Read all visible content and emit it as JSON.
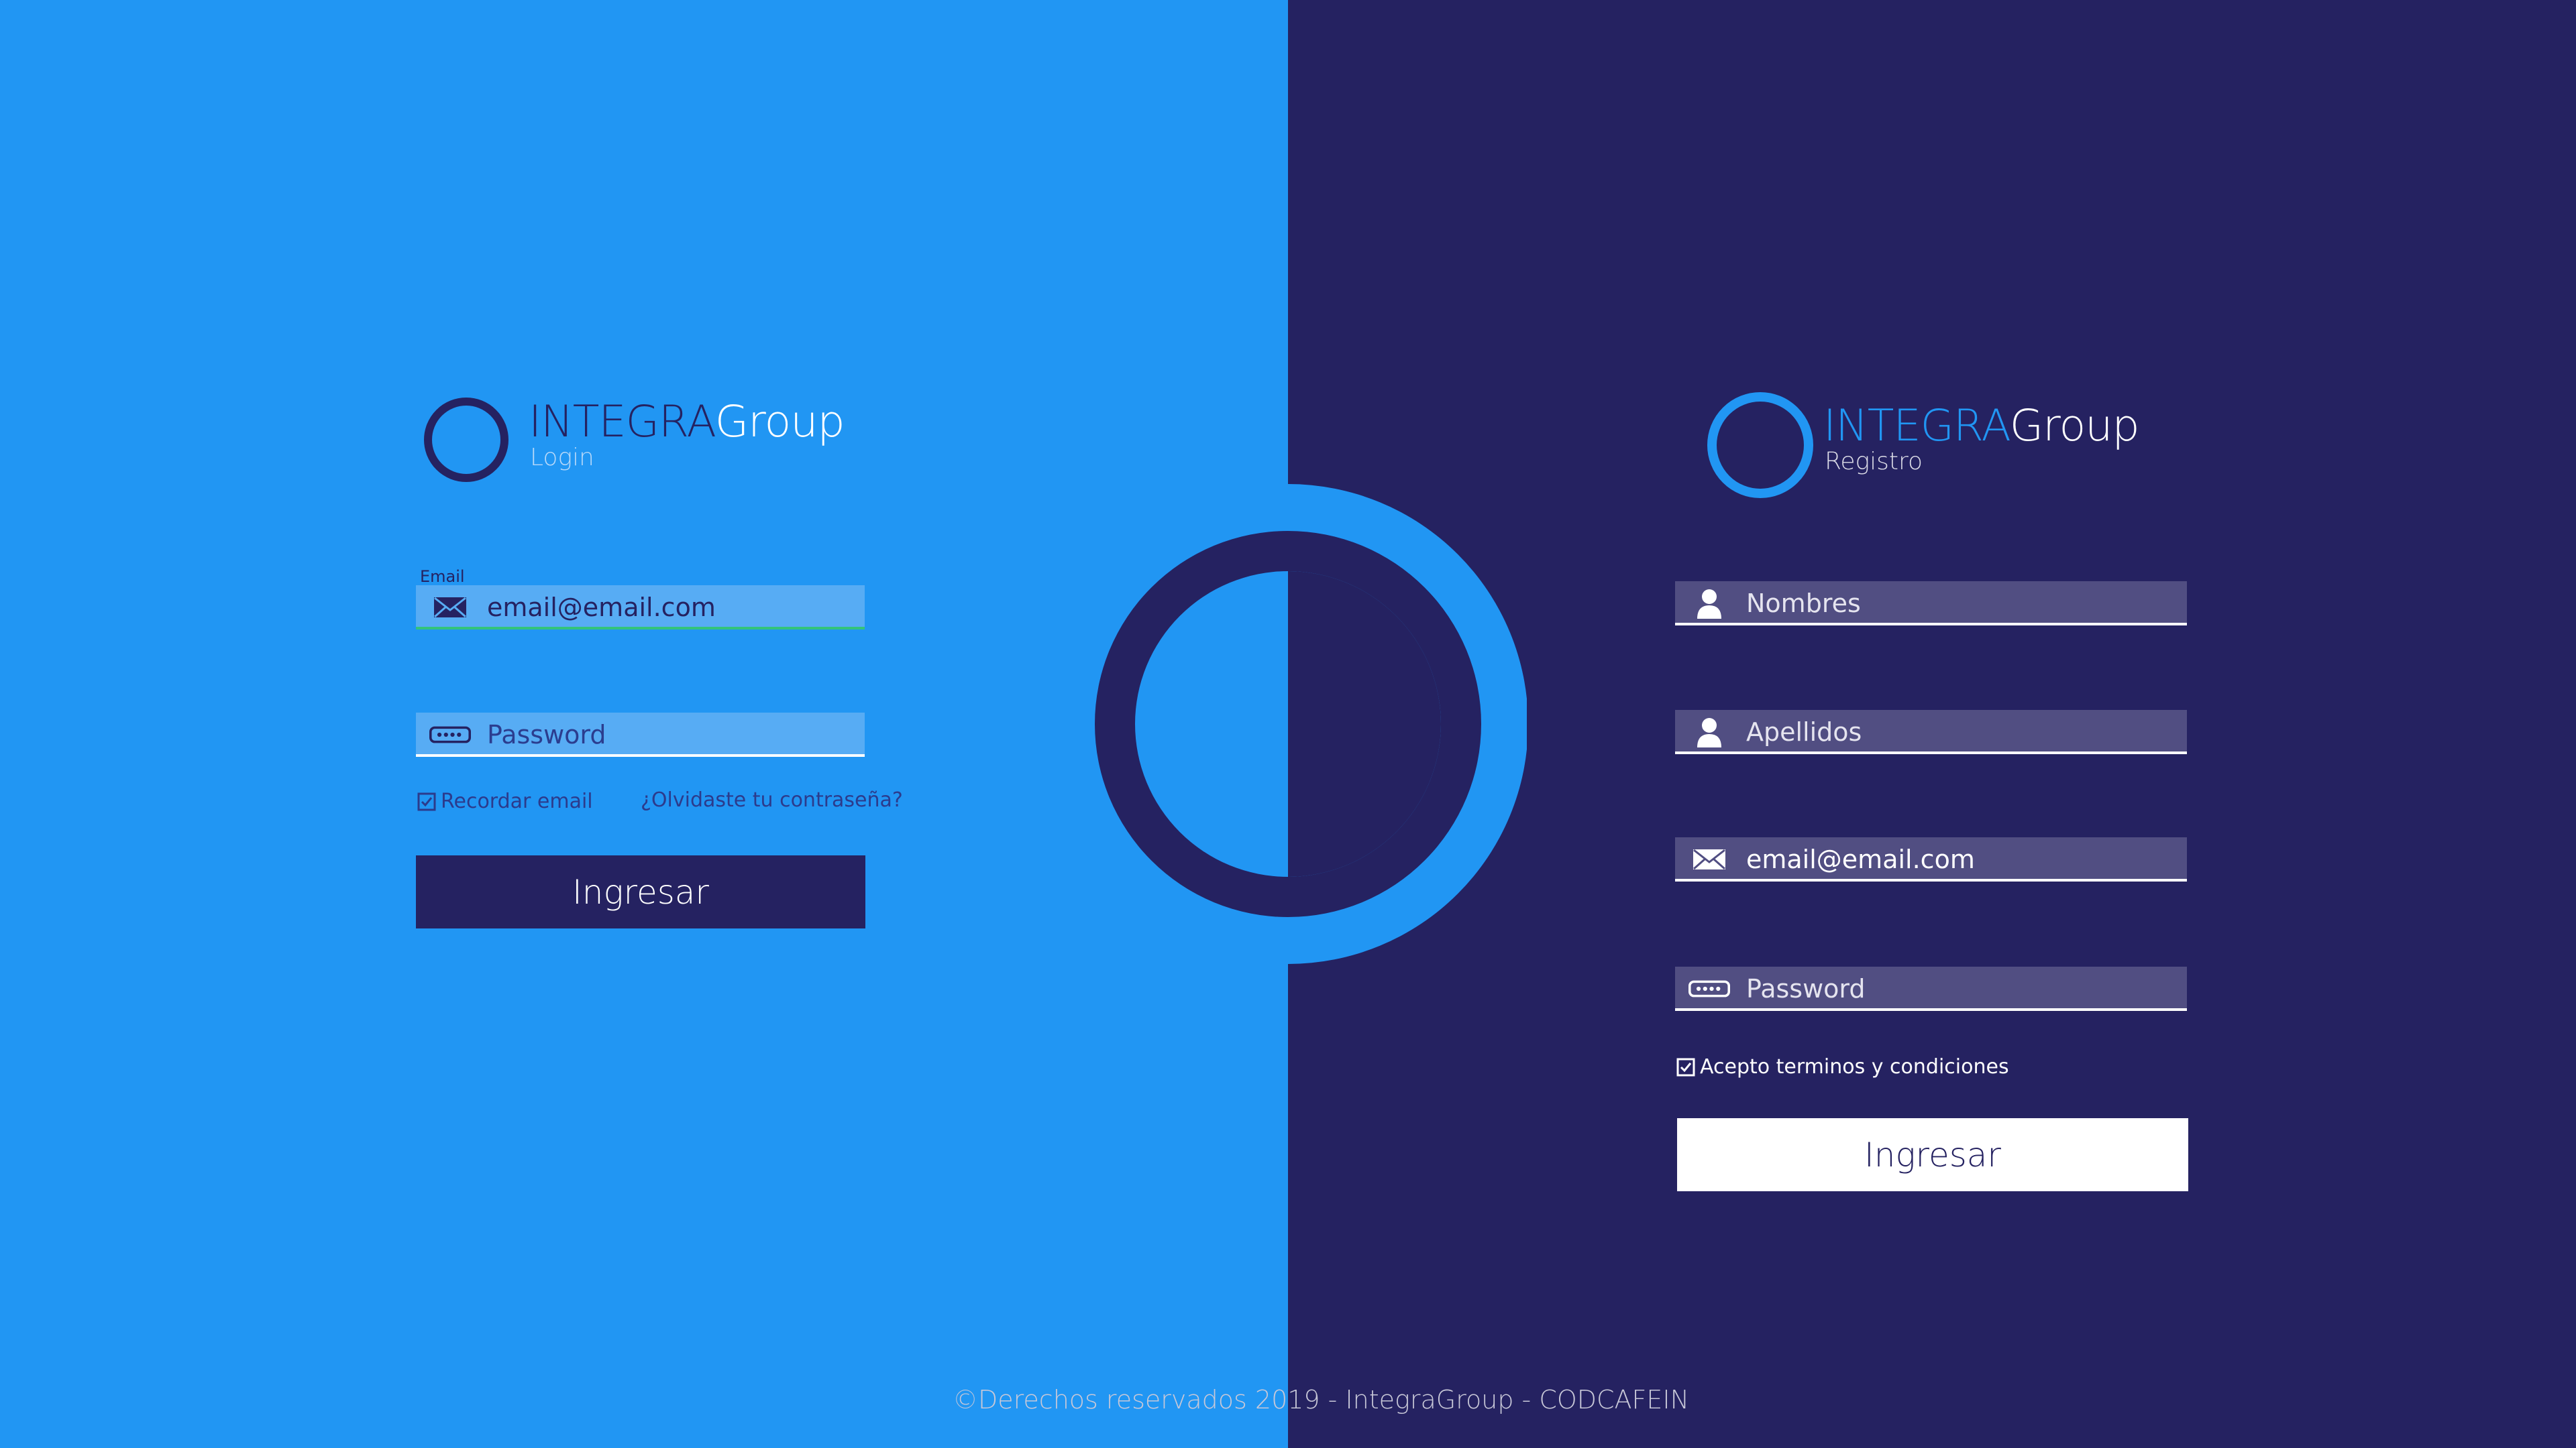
{
  "colors": {
    "blue": "#2196f3",
    "navy": "#252261",
    "white": "#ffffff"
  },
  "login": {
    "brand_prefix": "INTEGRA",
    "brand_suffix": "Group",
    "subtitle": "Login",
    "email_label": "Email",
    "email_value": "email@email.com",
    "email_icon": "envelope-icon",
    "password_placeholder": "Password",
    "password_icon": "password-dots-icon",
    "remember_label": "Recordar email",
    "remember_checked": true,
    "forgot_link": "¿Olvidaste tu contraseña?",
    "submit_label": "Ingresar"
  },
  "register": {
    "brand_prefix": "INTEGRA",
    "brand_suffix": "Group",
    "subtitle": "Registro",
    "names_placeholder": "Nombres",
    "surnames_placeholder": "Apellidos",
    "user_icon": "user-icon",
    "email_value": "email@email.com",
    "email_icon": "envelope-icon",
    "password_placeholder": "Password",
    "password_icon": "password-dots-icon",
    "terms_label": "Acepto terminos y condiciones",
    "terms_checked": true,
    "submit_label": "Ingresar"
  },
  "footer": {
    "text": "©Derechos reservados 2019 - IntegraGroup - CODCAFEIN"
  }
}
